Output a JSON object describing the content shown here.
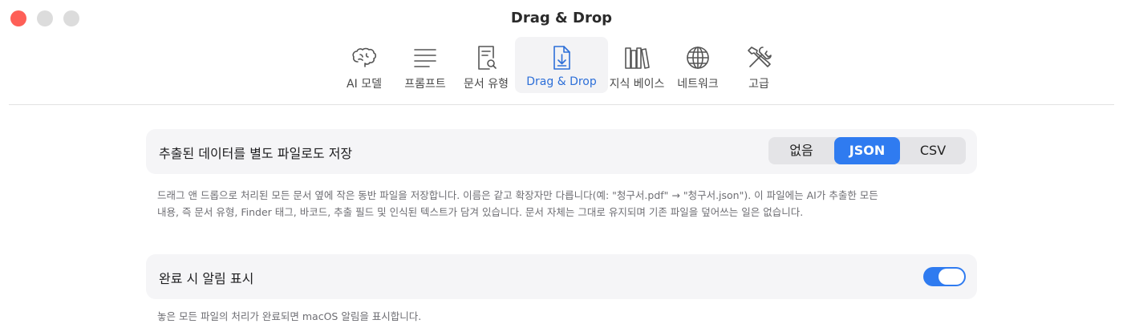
{
  "window": {
    "title": "Drag & Drop"
  },
  "toolbar": {
    "items": [
      {
        "label": "AI 모델",
        "icon": "brain-icon"
      },
      {
        "label": "프롬프트",
        "icon": "text-lines-icon"
      },
      {
        "label": "문서 유형",
        "icon": "document-search-icon"
      },
      {
        "label": "Drag & Drop",
        "icon": "document-download-icon",
        "selected": true
      },
      {
        "label": "지식 베이스",
        "icon": "books-icon"
      },
      {
        "label": "네트워크",
        "icon": "globe-icon"
      },
      {
        "label": "고급",
        "icon": "tools-icon"
      }
    ]
  },
  "export_setting": {
    "label": "추출된 데이터를 별도 파일로도 저장",
    "options": [
      "없음",
      "JSON",
      "CSV"
    ],
    "selected": "JSON",
    "description_line1": "드래그 앤 드롭으로 처리된 모든 문서 옆에 작은 동반 파일을 저장합니다. 이름은 같고 확장자만 다릅니다(예: \"청구서.pdf\" → \"청구서.json\"). 이 파일에는 AI가 추출한 모든",
    "description_line2": "내용, 즉 문서 유형, Finder 태그, 바코드, 추출 필드 및 인식된 텍스트가 담겨 있습니다. 문서 자체는 그대로 유지되며 기존 파일을 덮어쓰는 일은 없습니다."
  },
  "notification_setting": {
    "label": "완료 시 알림 표시",
    "enabled": true,
    "description": "놓은 모든 파일의 처리가 완료되면 macOS 알림을 표시합니다."
  },
  "colors": {
    "accent": "#2f7bf0",
    "close_button": "#fe5f57"
  }
}
